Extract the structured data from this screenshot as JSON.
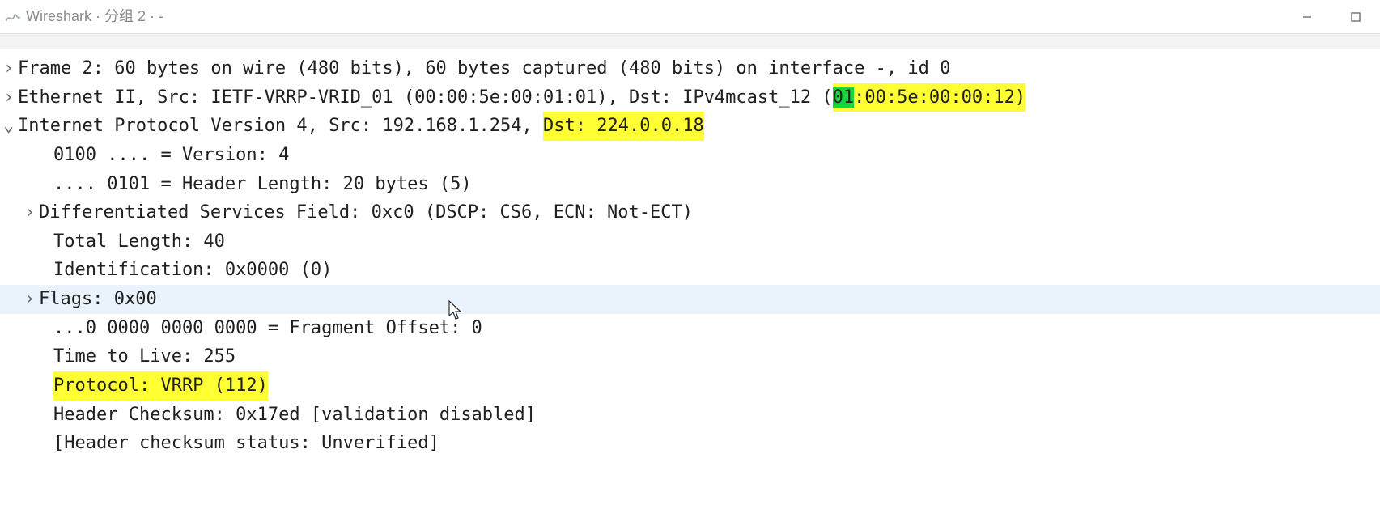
{
  "title": "Wireshark · 分组 2 · -",
  "rows": {
    "frame": "Frame 2: 60 bytes on wire (480 bits), 60 bytes captured (480 bits) on interface -, id 0",
    "eth_prefix": "Ethernet II, Src: IETF-VRRP-VRID_01 (00:00:5e:00:01:01), Dst: IPv4mcast_12 (",
    "eth_mac_first2": "01",
    "eth_mac_rest": ":00:5e:00:00:12)",
    "ip_prefix": "Internet Protocol Version 4, Src: 192.168.1.254, ",
    "ip_dst": "Dst: 224.0.0.18",
    "version": "0100 .... = Version: 4",
    "hdrlen": ".... 0101 = Header Length: 20 bytes (5)",
    "dsfield": "Differentiated Services Field: 0xc0 (DSCP: CS6, ECN: Not-ECT)",
    "totlen": "Total Length: 40",
    "ident": "Identification: 0x0000 (0)",
    "flags": "Flags: 0x00",
    "fragoff": "...0 0000 0000 0000 = Fragment Offset: 0",
    "ttl": "Time to Live: 255",
    "protocol": "Protocol: VRRP (112)",
    "chksum": "Header Checksum: 0x17ed [validation disabled]",
    "chkstat": "[Header checksum status: Unverified]"
  },
  "toggles": {
    "collapsed": "›",
    "expanded": "⌄"
  }
}
